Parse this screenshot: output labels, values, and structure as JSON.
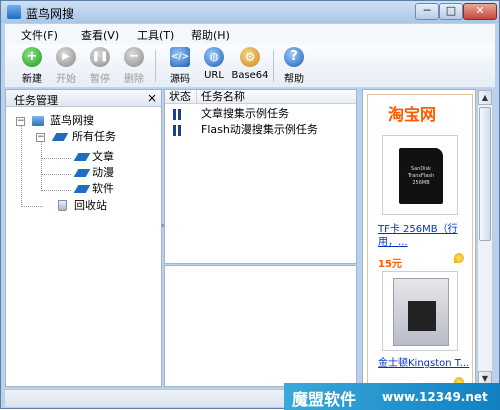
{
  "window": {
    "title": "蓝鸟网搜",
    "controls": {
      "minimize": "─",
      "maximize": "□",
      "close": "✕"
    }
  },
  "menu": [
    {
      "label": "文件(F)"
    },
    {
      "label": "查看(V)"
    },
    {
      "label": "工具(T)"
    },
    {
      "label": "帮助(H)"
    }
  ],
  "toolbar": [
    {
      "label": "新建",
      "icon": "new-plus-icon",
      "enabled": true
    },
    {
      "label": "开始",
      "icon": "play-icon",
      "enabled": false
    },
    {
      "label": "暂停",
      "icon": "pause-icon",
      "enabled": false
    },
    {
      "label": "删除",
      "icon": "minus-icon",
      "enabled": false
    },
    {
      "label": "源码",
      "icon": "source-code-icon",
      "enabled": true
    },
    {
      "label": "URL",
      "icon": "url-globe-icon",
      "enabled": true
    },
    {
      "label": "Base64",
      "icon": "base64-gear-icon",
      "enabled": true
    },
    {
      "label": "帮助",
      "icon": "help-question-icon",
      "enabled": true
    }
  ],
  "left_panel": {
    "title": "任务管理",
    "close": "×",
    "tree": {
      "root": "蓝鸟网搜",
      "all_tasks": "所有任务",
      "children": [
        "文章",
        "动漫",
        "软件"
      ],
      "recycle": "回收站"
    }
  },
  "task_list": {
    "columns": [
      "状态",
      "任务名称"
    ],
    "rows": [
      {
        "name": "文章搜集示例任务"
      },
      {
        "name": "Flash动漫搜集示例任务"
      }
    ]
  },
  "ad": {
    "brand": "淘宝网",
    "items": [
      {
        "title": "TF卡 256MB（行用，...",
        "price": "15元",
        "card_text": "SanDisk TransFlash 256MB"
      },
      {
        "title": "金士顿Kingston T...",
        "card_text": ""
      }
    ]
  },
  "watermark": {
    "brand": "魔盟软件",
    "url": "www.12349.net"
  },
  "colors": {
    "accent": "#1f6cc2",
    "taobao": "#ff5a00",
    "link": "#0033cc",
    "watermark": "#1a8bc9"
  }
}
